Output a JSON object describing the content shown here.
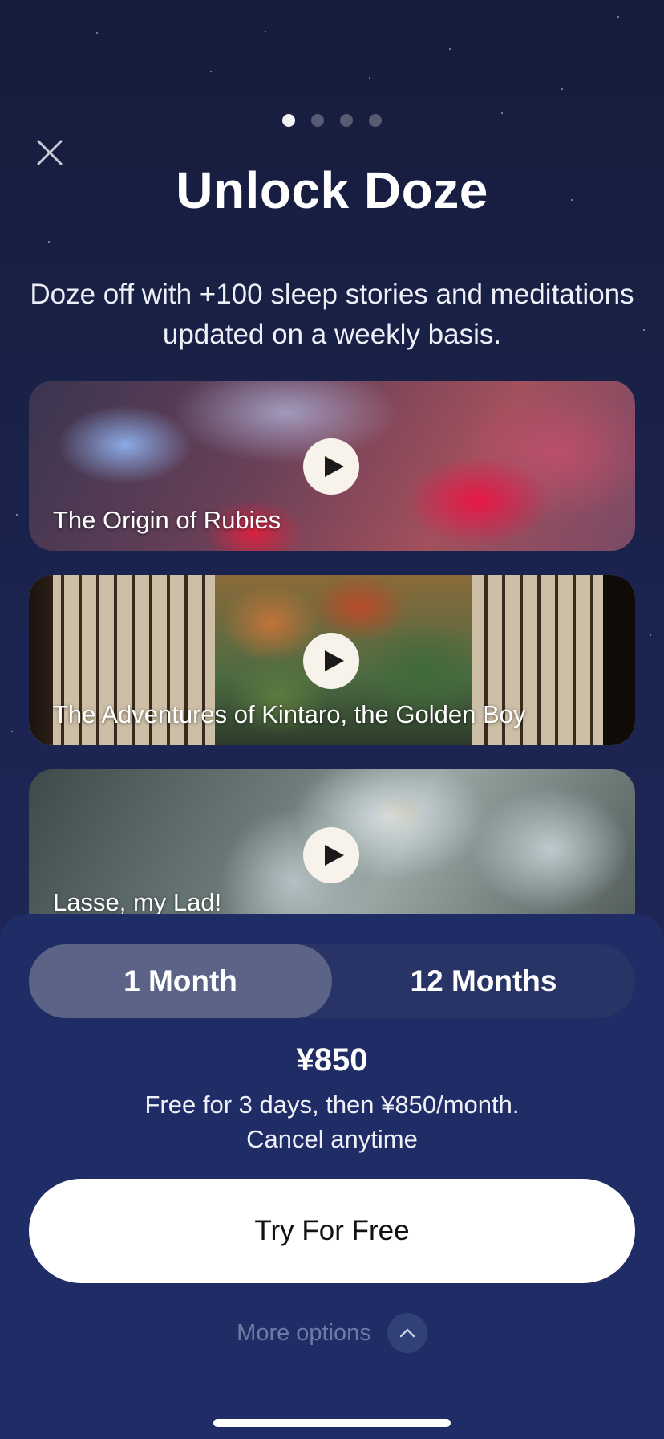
{
  "header": {
    "title": "Unlock Doze",
    "subtitle": "Doze off with +100 sleep stories and meditations updated on a weekly basis.",
    "page_indicator": {
      "count": 4,
      "active_index": 0
    },
    "close_icon": "close-icon"
  },
  "stories": [
    {
      "title": "The Origin of Rubies",
      "icon": "play-icon"
    },
    {
      "title": "The Adventures of Kintaro, the Golden Boy",
      "icon": "play-icon"
    },
    {
      "title": "Lasse, my Lad!",
      "icon": "play-icon"
    }
  ],
  "plans": {
    "options": [
      "1 Month",
      "12 Months"
    ],
    "selected": "1 Month"
  },
  "pricing": {
    "price": "¥850",
    "terms_line1": "Free for 3 days, then ¥850/month.",
    "terms_line2": "Cancel anytime"
  },
  "cta": {
    "label": "Try For Free"
  },
  "more_options": {
    "label": "More options",
    "icon": "chevron-up-icon"
  },
  "colors": {
    "background": "#1b2450",
    "sheet": "#1f2c66",
    "toggle_track": "#283466",
    "toggle_selected": "#5b6486",
    "cta_background": "#ffffff",
    "muted_text": "#6e7aa3"
  }
}
